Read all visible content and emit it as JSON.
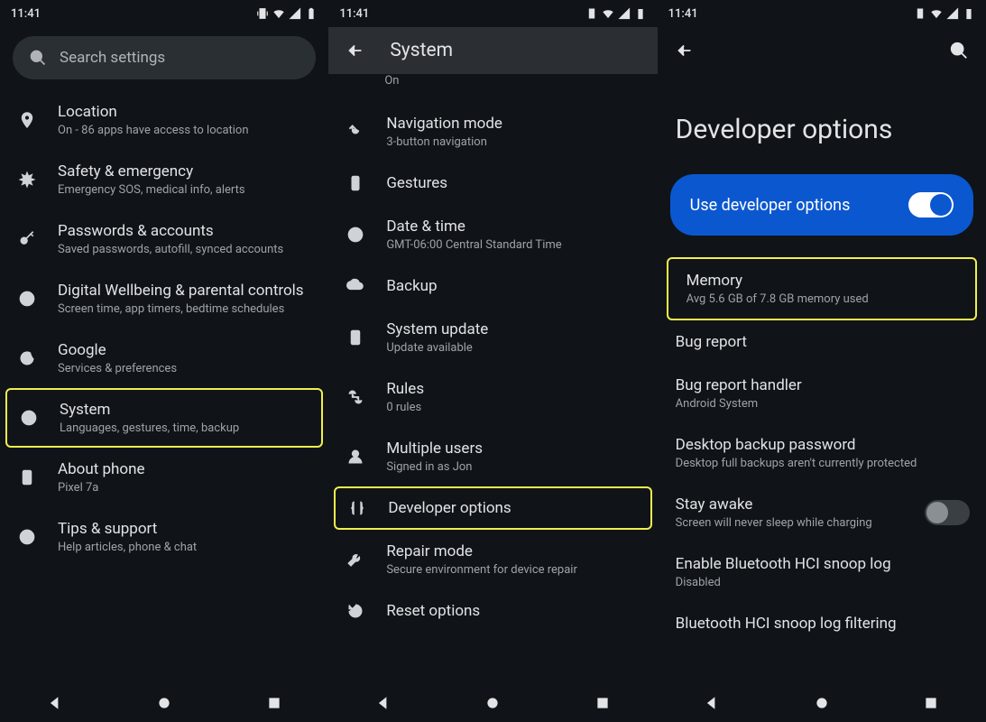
{
  "status": {
    "time": "11:41"
  },
  "phone1": {
    "search_placeholder": "Search settings",
    "items": [
      {
        "title": "Location",
        "sub": "On - 86 apps have access to location"
      },
      {
        "title": "Safety & emergency",
        "sub": "Emergency SOS, medical info, alerts"
      },
      {
        "title": "Passwords & accounts",
        "sub": "Saved passwords, autofill, synced accounts"
      },
      {
        "title": "Digital Wellbeing & parental controls",
        "sub": "Screen time, app timers, bedtime schedules"
      },
      {
        "title": "Google",
        "sub": "Services & preferences"
      },
      {
        "title": "System",
        "sub": "Languages, gestures, time, backup"
      },
      {
        "title": "About phone",
        "sub": "Pixel 7a"
      },
      {
        "title": "Tips & support",
        "sub": "Help articles, phone & chat"
      }
    ]
  },
  "phone2": {
    "appbar_title": "System",
    "partial_sub": "On",
    "items": [
      {
        "title": "Navigation mode",
        "sub": "3-button navigation"
      },
      {
        "title": "Gestures",
        "sub": ""
      },
      {
        "title": "Date & time",
        "sub": "GMT-06:00 Central Standard Time"
      },
      {
        "title": "Backup",
        "sub": ""
      },
      {
        "title": "System update",
        "sub": "Update available"
      },
      {
        "title": "Rules",
        "sub": "0 rules"
      },
      {
        "title": "Multiple users",
        "sub": "Signed in as Jon"
      },
      {
        "title": "Developer options",
        "sub": ""
      },
      {
        "title": "Repair mode",
        "sub": "Secure environment for device repair"
      },
      {
        "title": "Reset options",
        "sub": ""
      }
    ]
  },
  "phone3": {
    "page_title": "Developer options",
    "toggle_label": "Use developer options",
    "items": [
      {
        "title": "Memory",
        "sub": "Avg 5.6 GB of 7.8 GB memory used"
      },
      {
        "title": "Bug report",
        "sub": ""
      },
      {
        "title": "Bug report handler",
        "sub": "Android System"
      },
      {
        "title": "Desktop backup password",
        "sub": "Desktop full backups aren't currently protected"
      },
      {
        "title": "Stay awake",
        "sub": "Screen will never sleep while charging"
      },
      {
        "title": "Enable Bluetooth HCI snoop log",
        "sub": "Disabled"
      },
      {
        "title": "Bluetooth HCI snoop log filtering",
        "sub": ""
      }
    ]
  }
}
